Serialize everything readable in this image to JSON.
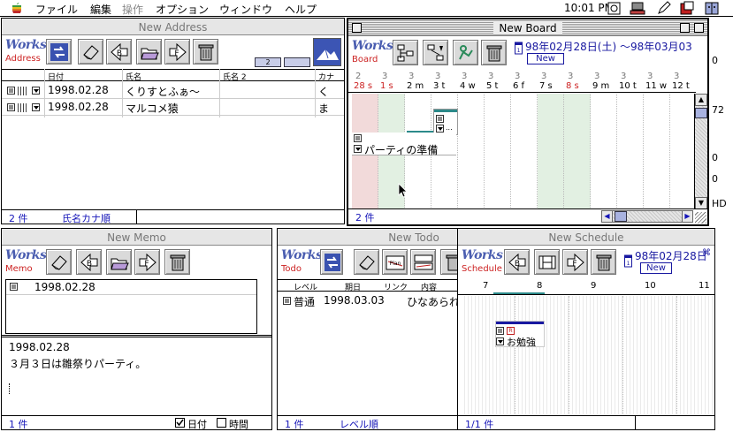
{
  "menubar": {
    "items": [
      "ファイル",
      "編集",
      "操作",
      "オプション",
      "ウィンドウ",
      "ヘルプ"
    ],
    "clock": "10:01 PM"
  },
  "desktop_right_text": [
    "0",
    "72",
    "0",
    "0",
    "HD"
  ],
  "address": {
    "title": "New Address",
    "logo_text": "Works",
    "logo_sub": "Address",
    "buttons": [
      "B",
      "F"
    ],
    "sort_buttons": [
      "2"
    ],
    "columns": [
      "日付",
      "氏名",
      "氏名 2",
      "カナ"
    ],
    "rows": [
      {
        "date": "1998.02.28",
        "name": "くりすとふぁ〜",
        "kana": "く"
      },
      {
        "date": "1998.02.28",
        "name": "マルコメ猿",
        "kana": "ま"
      }
    ],
    "status_count": "2 件",
    "status_sort": "氏名カナ順"
  },
  "board": {
    "title": "New Board",
    "logo_text": "Works",
    "logo_sub": "Board",
    "date_range": "98年02月28日(土) 〜98年03月03",
    "new_label": "New",
    "day_nums": [
      "2",
      "3",
      "3",
      "3",
      "3",
      "3",
      "3",
      "3",
      "3",
      "3",
      "3",
      "3",
      "3"
    ],
    "day_labels": [
      "28 s",
      "1 s",
      "2 m",
      "3 t",
      "4 w",
      "5 t",
      "6 f",
      "7 s",
      "8 s",
      "9 m",
      "10 t",
      "11 w",
      "12 t"
    ],
    "weekend_red": [
      0,
      1,
      8
    ],
    "shaded_cols": [
      0,
      1,
      7,
      8
    ],
    "event_label": "パーティの準備",
    "event_cell_text": "...",
    "status_count": "2 件",
    "colors": {
      "weekend_red": "#cc2222",
      "shade_red": "#f2dada",
      "shade_green": "#e2f0e2",
      "bar_teal": "#2c8a8a"
    }
  },
  "memo": {
    "title": "New Memo",
    "logo_text": "Works",
    "logo_sub": "Memo",
    "buttons": [
      "B",
      "F"
    ],
    "list_date": "1998.02.28",
    "body_date": "1998.02.28",
    "body_text": "３月３日は雛祭りパーティ。",
    "status_count": "1 件",
    "check_date": "日付",
    "check_time": "時間"
  },
  "todo": {
    "title": "New Todo",
    "logo_text": "Works",
    "logo_sub": "Todo",
    "columns": [
      "レベル",
      "期日",
      "リンク",
      "内容"
    ],
    "row": {
      "level": "普通",
      "due": "1998.03.03",
      "content": "ひなあられ"
    },
    "status_count": "1 件",
    "status_sort": "レベル順"
  },
  "schedule": {
    "title": "New Schedule",
    "logo_text": "Works",
    "logo_sub": "Schedule",
    "buttons": [
      "B",
      "F"
    ],
    "date": "98年02月28日",
    "new_label": "New",
    "hours": [
      "7",
      "8",
      "9",
      "10",
      "11"
    ],
    "event_label": "お勉強",
    "status_count": "1/1 件"
  }
}
